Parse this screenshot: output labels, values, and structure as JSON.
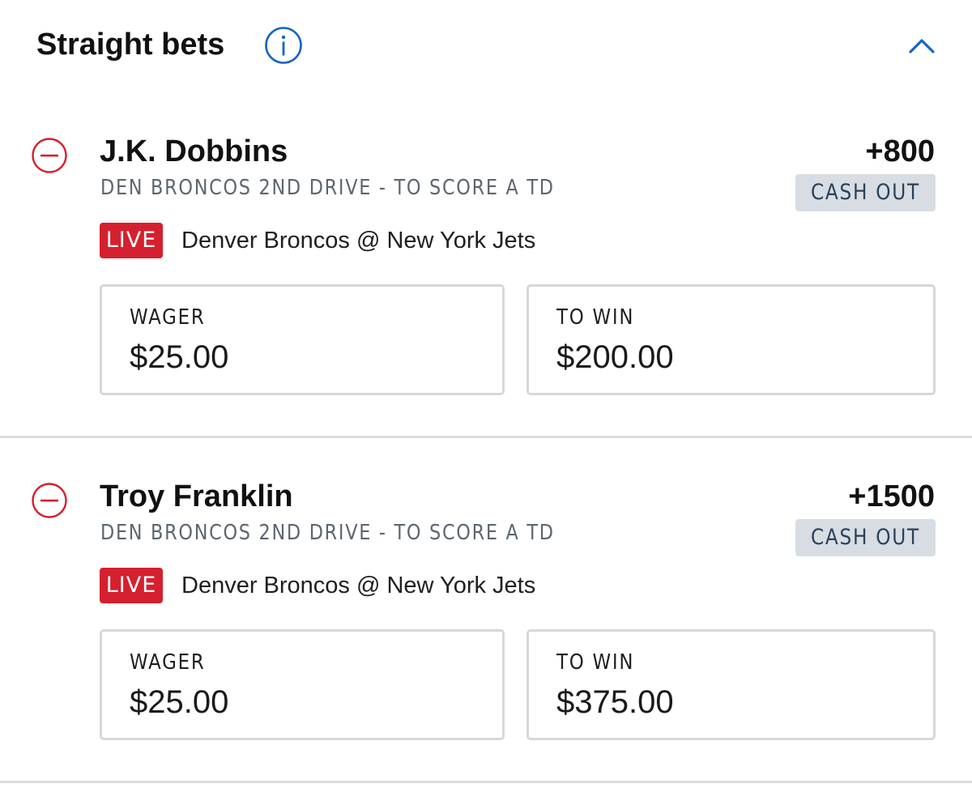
{
  "header": {
    "title": "Straight bets",
    "info_icon": "info-circle-icon",
    "collapse_icon": "chevron-up-icon"
  },
  "colors": {
    "accent_blue": "#1565c0",
    "remove_red": "#d5202f",
    "live_red": "#d5202f",
    "cashout_bg": "#d7dde3",
    "cashout_text": "#2b4158",
    "market_gray": "#5c6670",
    "border_gray": "#d4d8dc"
  },
  "bets": [
    {
      "player": "J.K. Dobbins",
      "market": "DEN BRONCOS 2ND DRIVE - TO SCORE A TD",
      "odds": "+800",
      "cashout_label": "CASH OUT",
      "live_label": "LIVE",
      "event": "Denver Broncos @ New York Jets",
      "wager_label": "WAGER",
      "wager_value": "$25.00",
      "to_win_label": "TO WIN",
      "to_win_value": "$200.00"
    },
    {
      "player": "Troy Franklin",
      "market": "DEN BRONCOS 2ND DRIVE - TO SCORE A TD",
      "odds": "+1500",
      "cashout_label": "CASH OUT",
      "live_label": "LIVE",
      "event": "Denver Broncos @ New York Jets",
      "wager_label": "WAGER",
      "wager_value": "$25.00",
      "to_win_label": "TO WIN",
      "to_win_value": "$375.00"
    }
  ]
}
